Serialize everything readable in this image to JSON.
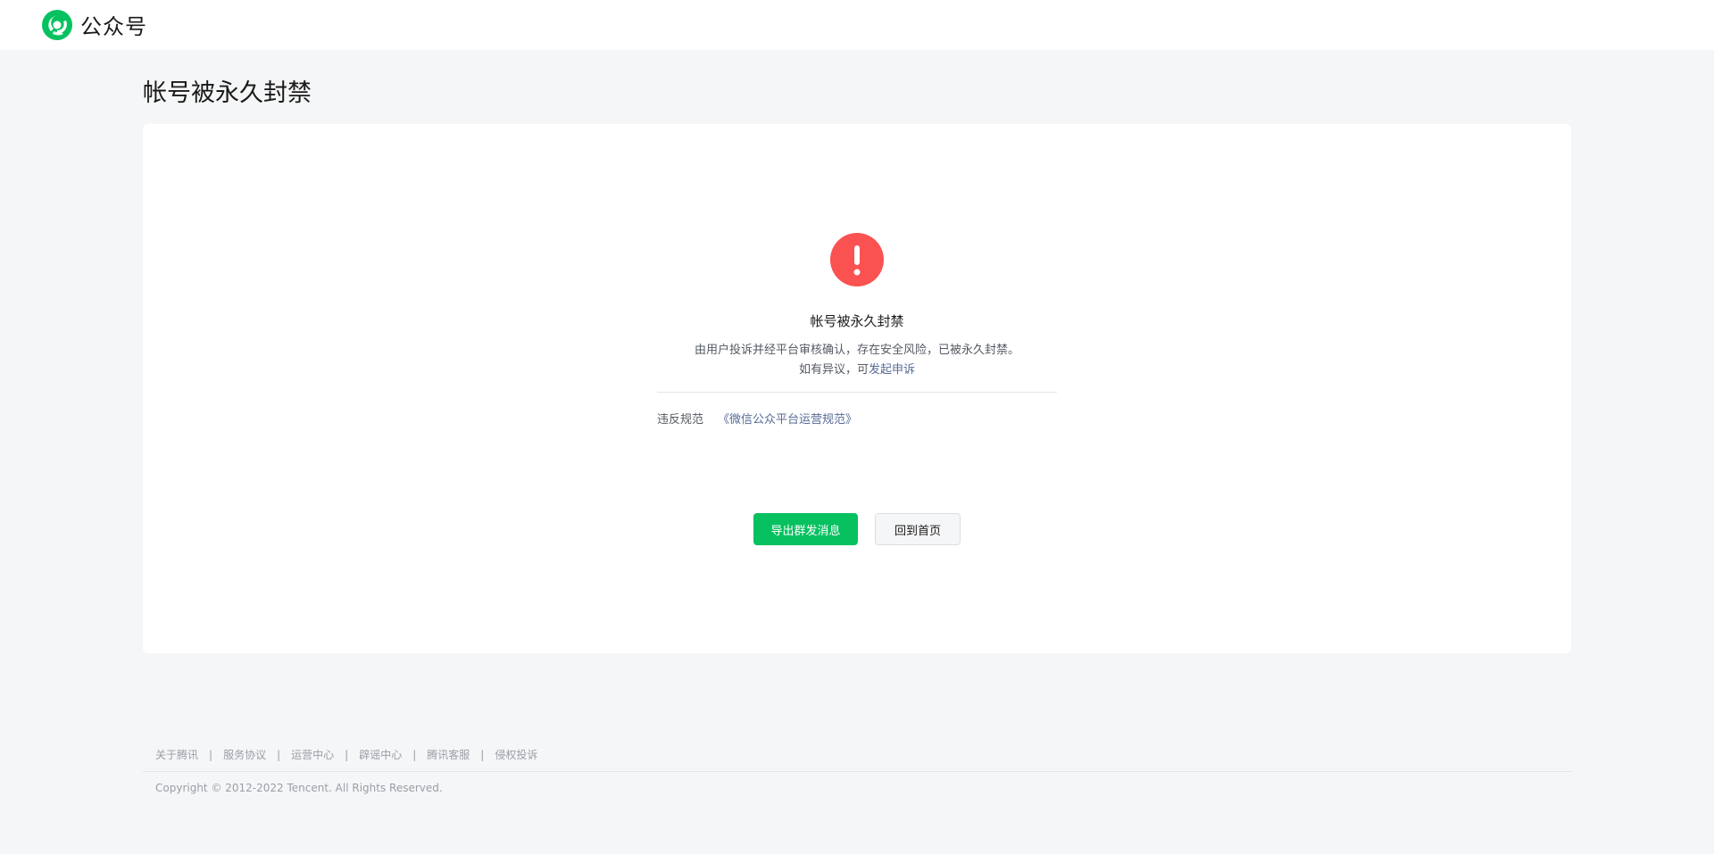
{
  "header": {
    "logo_text": "公众号",
    "brand_color": "#07c160"
  },
  "page": {
    "title": "帐号被永久封禁"
  },
  "notice": {
    "icon": "exclamation-icon",
    "icon_color": "#fa5151",
    "title": "帐号被永久封禁",
    "description": "由用户投诉并经平台审核确认，存在安全风险，已被永久封禁。",
    "appeal_prefix": "如有异议，可",
    "appeal_link": "发起申诉",
    "violation_label": "违反规范",
    "violation_rule": "《微信公众平台运营规范》"
  },
  "actions": {
    "export_label": "导出群发消息",
    "home_label": "回到首页"
  },
  "footer": {
    "links": [
      "关于腾讯",
      "服务协议",
      "运营中心",
      "辟谣中心",
      "腾讯客服",
      "侵权投诉"
    ],
    "separator": "|",
    "copyright": "Copyright © 2012-2022 Tencent. All Rights Reserved."
  }
}
